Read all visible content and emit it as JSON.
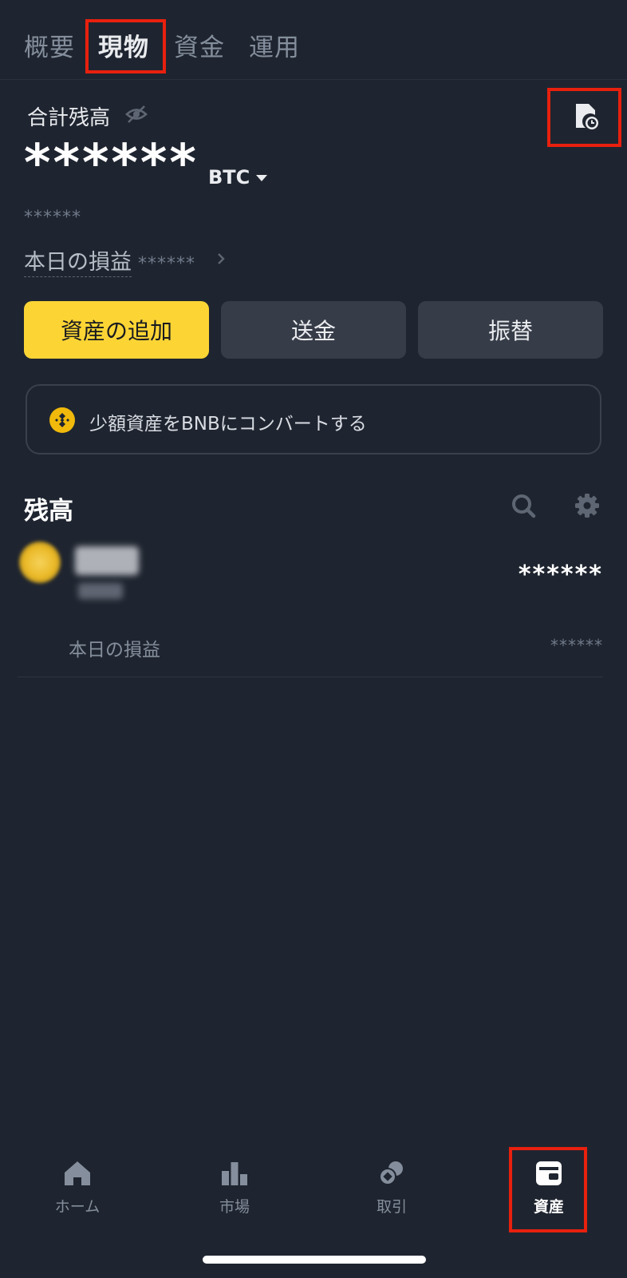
{
  "tabs": [
    {
      "label": "概要"
    },
    {
      "label": "現物"
    },
    {
      "label": "資金"
    },
    {
      "label": "運用"
    }
  ],
  "balance": {
    "label": "合計残高",
    "value": "******",
    "currency": "BTC",
    "sub_value": "******",
    "pnl_label": "本日の損益",
    "pnl_value": "******"
  },
  "actions": {
    "add": "資産の追加",
    "send": "送金",
    "transfer": "振替"
  },
  "convert": {
    "text": "少額資産をBNBにコンバートする"
  },
  "holdings": {
    "title": "残高",
    "items": [
      {
        "amount": "******",
        "pnl_label": "本日の損益",
        "pnl_value": "******"
      }
    ]
  },
  "nav": [
    {
      "label": "ホーム",
      "icon": "home-icon"
    },
    {
      "label": "市場",
      "icon": "markets-icon"
    },
    {
      "label": "取引",
      "icon": "trade-icon"
    },
    {
      "label": "資産",
      "icon": "wallet-icon"
    }
  ],
  "colors": {
    "background": "#1f2530",
    "accent": "#fcd535",
    "highlight": "#e8200e"
  }
}
